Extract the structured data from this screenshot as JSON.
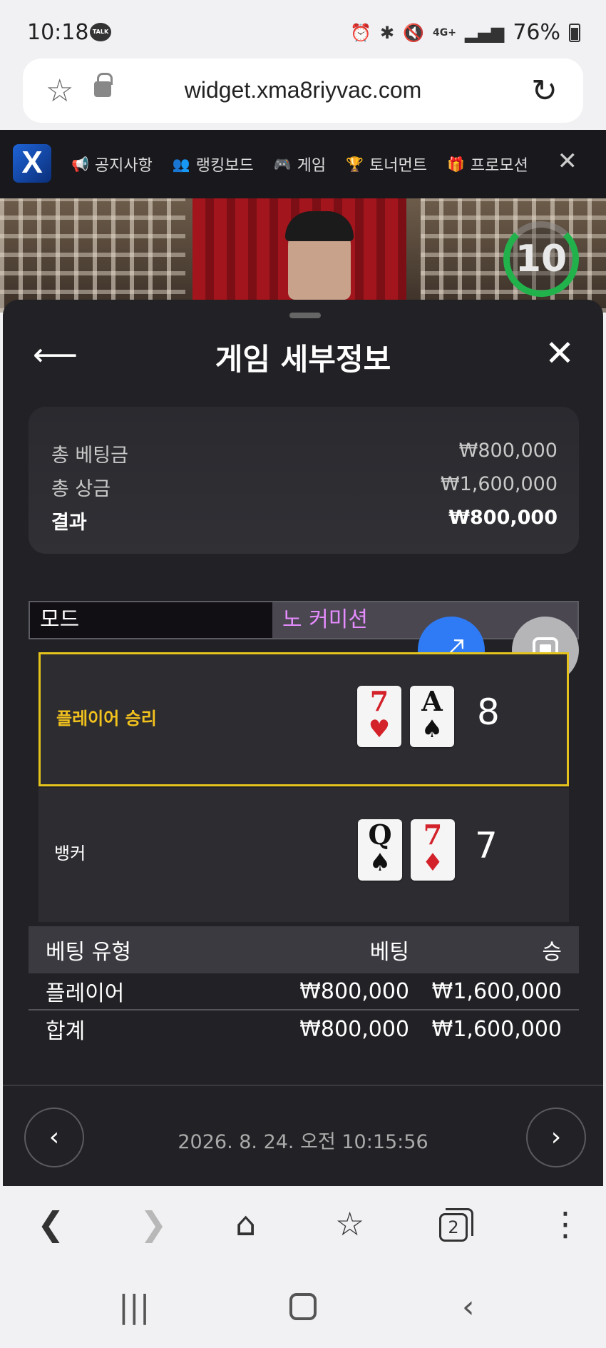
{
  "status_bar": {
    "time": "10:18",
    "talk_badge": "TALK",
    "network": "4G+",
    "battery": "76%"
  },
  "browser": {
    "url": "widget.xma8riyvac.com",
    "tab_count": "2"
  },
  "site_nav": {
    "logo": "X",
    "items": [
      {
        "icon": "megaphone-icon",
        "label": "공지사항"
      },
      {
        "icon": "users-icon",
        "label": "랭킹보드"
      },
      {
        "icon": "gamepad-icon",
        "label": "게임"
      },
      {
        "icon": "trophy-icon",
        "label": "토너먼트"
      },
      {
        "icon": "gift-icon",
        "label": "프로모션"
      }
    ]
  },
  "video": {
    "timer": "10"
  },
  "sheet": {
    "title": "게임 세부정보",
    "summary": [
      {
        "label": "총 베팅금",
        "value": "₩800,000"
      },
      {
        "label": "총 상금",
        "value": "₩1,600,000"
      },
      {
        "label": "결과",
        "value": "₩800,000"
      }
    ],
    "mode_label": "모드",
    "mode_value": "노 커미션",
    "player": {
      "label": "플레이어 승리",
      "cards": [
        {
          "rank": "7",
          "suit": "♥",
          "color": "#d3222a"
        },
        {
          "rank": "A",
          "suit": "♠",
          "color": "#111111"
        }
      ],
      "score": "8"
    },
    "banker": {
      "label": "뱅커",
      "cards": [
        {
          "rank": "Q",
          "suit": "♠",
          "color": "#111111"
        },
        {
          "rank": "7",
          "suit": "♦",
          "color": "#d3222a"
        }
      ],
      "score": "7"
    },
    "bets_table": {
      "headers": [
        "베팅 유형",
        "베팅",
        "승"
      ],
      "rows": [
        [
          "플레이어",
          "₩800,000",
          "₩1,600,000"
        ],
        [
          "합계",
          "₩800,000",
          "₩1,600,000"
        ]
      ]
    },
    "timestamp": "2026. 8. 24. 오전 10:15:56"
  },
  "colors": {
    "accent": "#2f7bf5",
    "win_border": "#e3c31c",
    "mode_value": "#e58cff",
    "timer": "#22b24c"
  }
}
